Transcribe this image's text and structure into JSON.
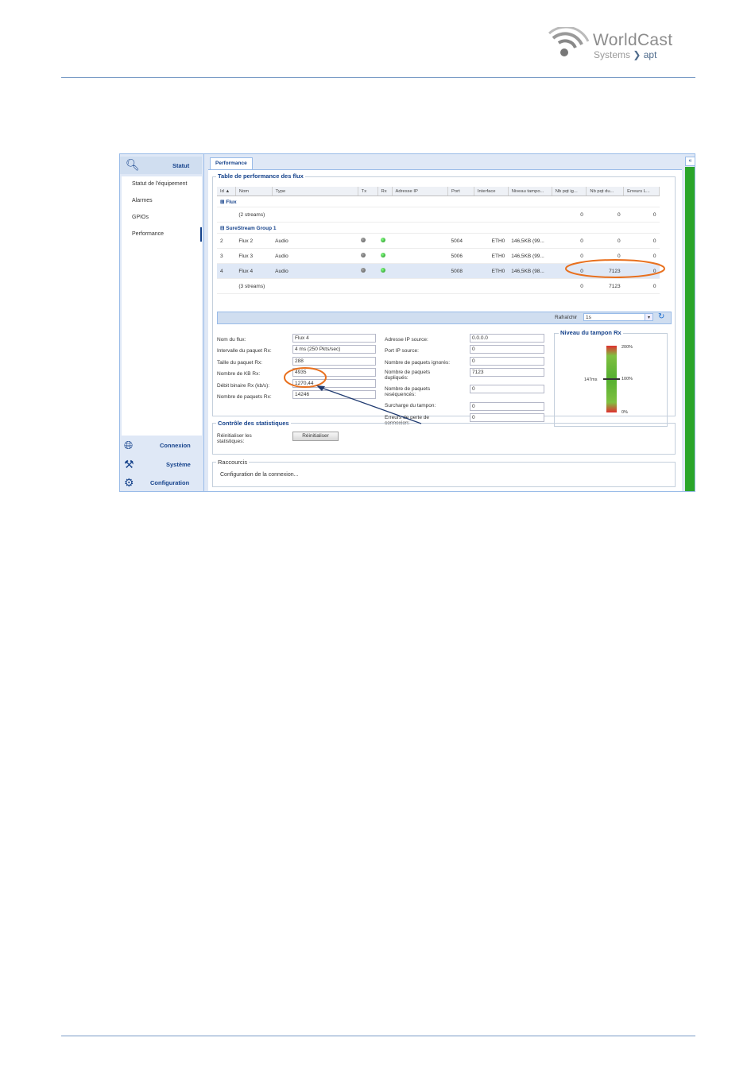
{
  "logo": {
    "name": "WorldCast",
    "sub_a": "Systems",
    "sub_b": "apt"
  },
  "sidebar": {
    "statut_label": "Statut",
    "items": [
      "Statut de l'équipement",
      "Alarmes",
      "GPIOs",
      "Performance"
    ],
    "connexion_label": "Connexion",
    "systeme_label": "Système",
    "configuration_label": "Configuration"
  },
  "tab": {
    "label": "Performance"
  },
  "perf_table": {
    "title": "Table de performance des flux",
    "columns": [
      "Id ▲",
      "Nom",
      "Type",
      "Tx",
      "Rx",
      "Adresse IP",
      "Port",
      "Interface",
      "Niveau tampo...",
      "Nb pqt ig...",
      "Nb pqt du...",
      "Erreurs L..."
    ],
    "group1": {
      "label": "⊞ Flux",
      "summary": "(2 streams)",
      "ignored": "0",
      "dup": "0",
      "err": "0"
    },
    "group2": {
      "label": "⊟ SureStream Group 1",
      "summary": "(3 streams)",
      "ignored": "0",
      "dup": "7123",
      "err": "0"
    },
    "rows": [
      {
        "id": "2",
        "name": "Flux 2",
        "type": "Audio",
        "port": "5004",
        "iface": "ETH0",
        "level": "146,5KB (99...",
        "ignored": "0",
        "dup": "0",
        "err": "0"
      },
      {
        "id": "3",
        "name": "Flux 3",
        "type": "Audio",
        "port": "5006",
        "iface": "ETH0",
        "level": "146,5KB (99...",
        "ignored": "0",
        "dup": "0",
        "err": "0"
      },
      {
        "id": "4",
        "name": "Flux 4",
        "type": "Audio",
        "port": "5008",
        "iface": "ETH0",
        "level": "146,5KB (98...",
        "ignored": "0",
        "dup": "7123",
        "err": "0"
      }
    ],
    "refresh_label": "Rafraîchir",
    "refresh_value": "1s"
  },
  "details": {
    "left": [
      {
        "label": "Nom du flux:",
        "value": "Flux 4"
      },
      {
        "label": "Intervalle du paquet Rx:",
        "value": "4 ms (250 Pkts/sec)"
      },
      {
        "label": "Taille du paquet Rx:",
        "value": "288"
      },
      {
        "label": "Nombre de KB Rx:",
        "value": "4935"
      },
      {
        "label": "Débit binaire Rx (kb/s):",
        "value": "1270,44"
      },
      {
        "label": "Nombre de paquets Rx:",
        "value": "14246"
      }
    ],
    "right": [
      {
        "label": "Adresse IP source:",
        "value": "0.0.0.0"
      },
      {
        "label": "Port IP source:",
        "value": "0"
      },
      {
        "label": "Nombre de paquets ignorés:",
        "value": "0"
      },
      {
        "label": "Nombre de paquets dupliqués:",
        "value": "7123"
      },
      {
        "label": "Nombre de paquets reséquencés:",
        "value": "0"
      },
      {
        "label": "Surcharge du tampon:",
        "value": "0"
      },
      {
        "label": "Erreurs de perte de connexion:",
        "value": "0"
      }
    ]
  },
  "gauge": {
    "title": "Niveau du tampon Rx",
    "top": "200%",
    "mid": "100%",
    "bottom": "0%",
    "current": "147ms",
    "level_percent": 100
  },
  "stats": {
    "title": "Contrôle des statistiques",
    "reset_label": "Réinitialiser les statistiques:",
    "reset_button": "Réinitialiser"
  },
  "shortcuts": {
    "title": "Raccourcis",
    "link": "Configuration de la connexion..."
  },
  "annotation_colors": {
    "circle": "#e8701e",
    "arrow": "#1f3a70"
  }
}
